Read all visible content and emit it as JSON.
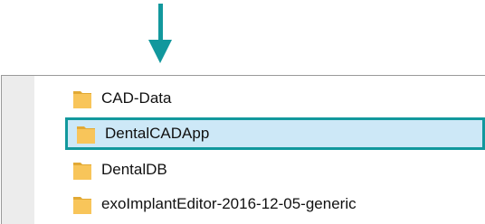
{
  "annotation": {
    "arrow_color": "#12989d",
    "arrow_icon": "down-arrow-icon"
  },
  "explorer": {
    "files": [
      {
        "name": "CAD-Data",
        "icon": "folder-icon",
        "selected": false
      },
      {
        "name": "DentalCADApp",
        "icon": "folder-icon",
        "selected": true
      },
      {
        "name": "DentalDB",
        "icon": "folder-icon",
        "selected": false
      },
      {
        "name": "exoImplantEditor-2016-12-05-generic",
        "icon": "folder-icon",
        "selected": false
      }
    ],
    "selection_highlight": "#cde8f7",
    "selection_border": "#12989d",
    "folder_color": "#f8c55a"
  }
}
